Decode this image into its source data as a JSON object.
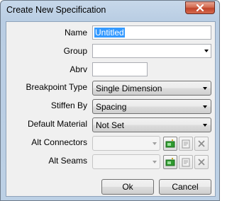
{
  "window": {
    "title": "Create New Specification",
    "close_icon": "close-icon"
  },
  "form": {
    "name": {
      "label": "Name",
      "value": "Untitled"
    },
    "group": {
      "label": "Group",
      "value": ""
    },
    "abrv": {
      "label": "Abrv",
      "value": ""
    },
    "breakpoint_type": {
      "label": "Breakpoint Type",
      "value": "Single Dimension"
    },
    "stiffen_by": {
      "label": "Stiffen By",
      "value": "Spacing"
    },
    "default_material": {
      "label": "Default Material",
      "value": "Not Set"
    },
    "alt_connectors": {
      "label": "Alt Connectors",
      "value": ""
    },
    "alt_seams": {
      "label": "Alt Seams",
      "value": ""
    }
  },
  "buttons": {
    "ok": "Ok",
    "cancel": "Cancel"
  },
  "icons": {
    "add": "add-icon",
    "properties": "properties-icon",
    "delete": "delete-icon"
  },
  "colors": {
    "selection": "#3399ff",
    "close_button": "#c0442a",
    "title_bar": "#bcd0e5"
  }
}
